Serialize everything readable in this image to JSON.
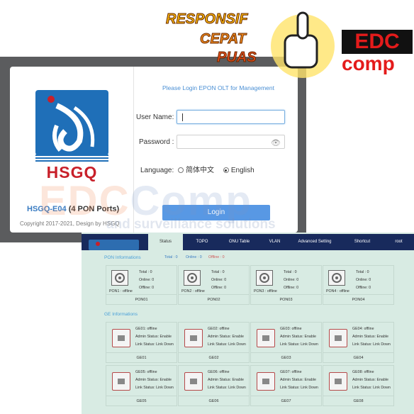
{
  "promo": {
    "words": [
      "RESPONSIF",
      "CEPAT",
      "PUAS"
    ],
    "logo_top": "EDC",
    "logo_bottom": "comp"
  },
  "watermark": {
    "main_a": "EDC",
    "main_b": "Comp",
    "sub": "and surveillance solutions"
  },
  "login": {
    "brand": "HSGQ",
    "model_name": "HSGQ-E04",
    "model_ports": "(4 PON Ports)",
    "copyright": "Copyright 2017-2021, Design by HSGQ",
    "title": "Please Login EPON OLT for Management",
    "username_label": "User Name:",
    "username_value": "",
    "password_label": "Password :",
    "password_value": "",
    "language_label": "Language:",
    "languages": [
      "简体中文",
      "English"
    ],
    "selected_language": "English",
    "login_button": "Login"
  },
  "dashboard": {
    "tabs": [
      "Status",
      "TOPO",
      "ONU Table",
      "VLAN",
      "Advanced Setting",
      "Shortcut",
      "root"
    ],
    "active_tab": "Status",
    "pon_section": "PON Informations",
    "pon_summary": {
      "total": "Total : 0",
      "online": "Online : 0",
      "offline": "Offline : 0"
    },
    "pon_ports": [
      {
        "status": "PON1 : offline",
        "total": "Total : 0",
        "online": "Online: 0",
        "offline": "Offline: 0",
        "name": "PON01"
      },
      {
        "status": "PON2 : offline",
        "total": "Total : 0",
        "online": "Online: 0",
        "offline": "Offline: 0",
        "name": "PON02"
      },
      {
        "status": "PON3 : offline",
        "total": "Total : 0",
        "online": "Online: 0",
        "offline": "Offline: 0",
        "name": "PON03"
      },
      {
        "status": "PON4 : offline",
        "total": "Total : 0",
        "online": "Online: 0",
        "offline": "Offline: 0",
        "name": "PON04"
      }
    ],
    "ge_section": "GE Informations",
    "ge_ports": [
      {
        "status": "GE01: offline",
        "admin": "Admin Status: Enable",
        "link": "Link Status: Link Down",
        "name": "GE01"
      },
      {
        "status": "GE02: offline",
        "admin": "Admin Status: Enable",
        "link": "Link Status: Link Down",
        "name": "GE02"
      },
      {
        "status": "GE03: offline",
        "admin": "Admin Status: Enable",
        "link": "Link Status: Link Down",
        "name": "GE03"
      },
      {
        "status": "GE04: offline",
        "admin": "Admin Status: Enable",
        "link": "Link Status: Link Down",
        "name": "GE04"
      },
      {
        "status": "GE05: offline",
        "admin": "Admin Status: Enable",
        "link": "Link Status: Link Down",
        "name": "GE05"
      },
      {
        "status": "GE06: offline",
        "admin": "Admin Status: Enable",
        "link": "Link Status: Link Down",
        "name": "GE06"
      },
      {
        "status": "GE07: offline",
        "admin": "Admin Status: Enable",
        "link": "Link Status: Link Down",
        "name": "GE07"
      },
      {
        "status": "GE08: offline",
        "admin": "Admin Status: Enable",
        "link": "Link Status: Link Down",
        "name": "GE08"
      }
    ]
  },
  "colors": {
    "nav": "#182a5c",
    "accent": "#4a90e2",
    "brand_red": "#c8202a",
    "dash_bg": "#d8ebe3"
  }
}
